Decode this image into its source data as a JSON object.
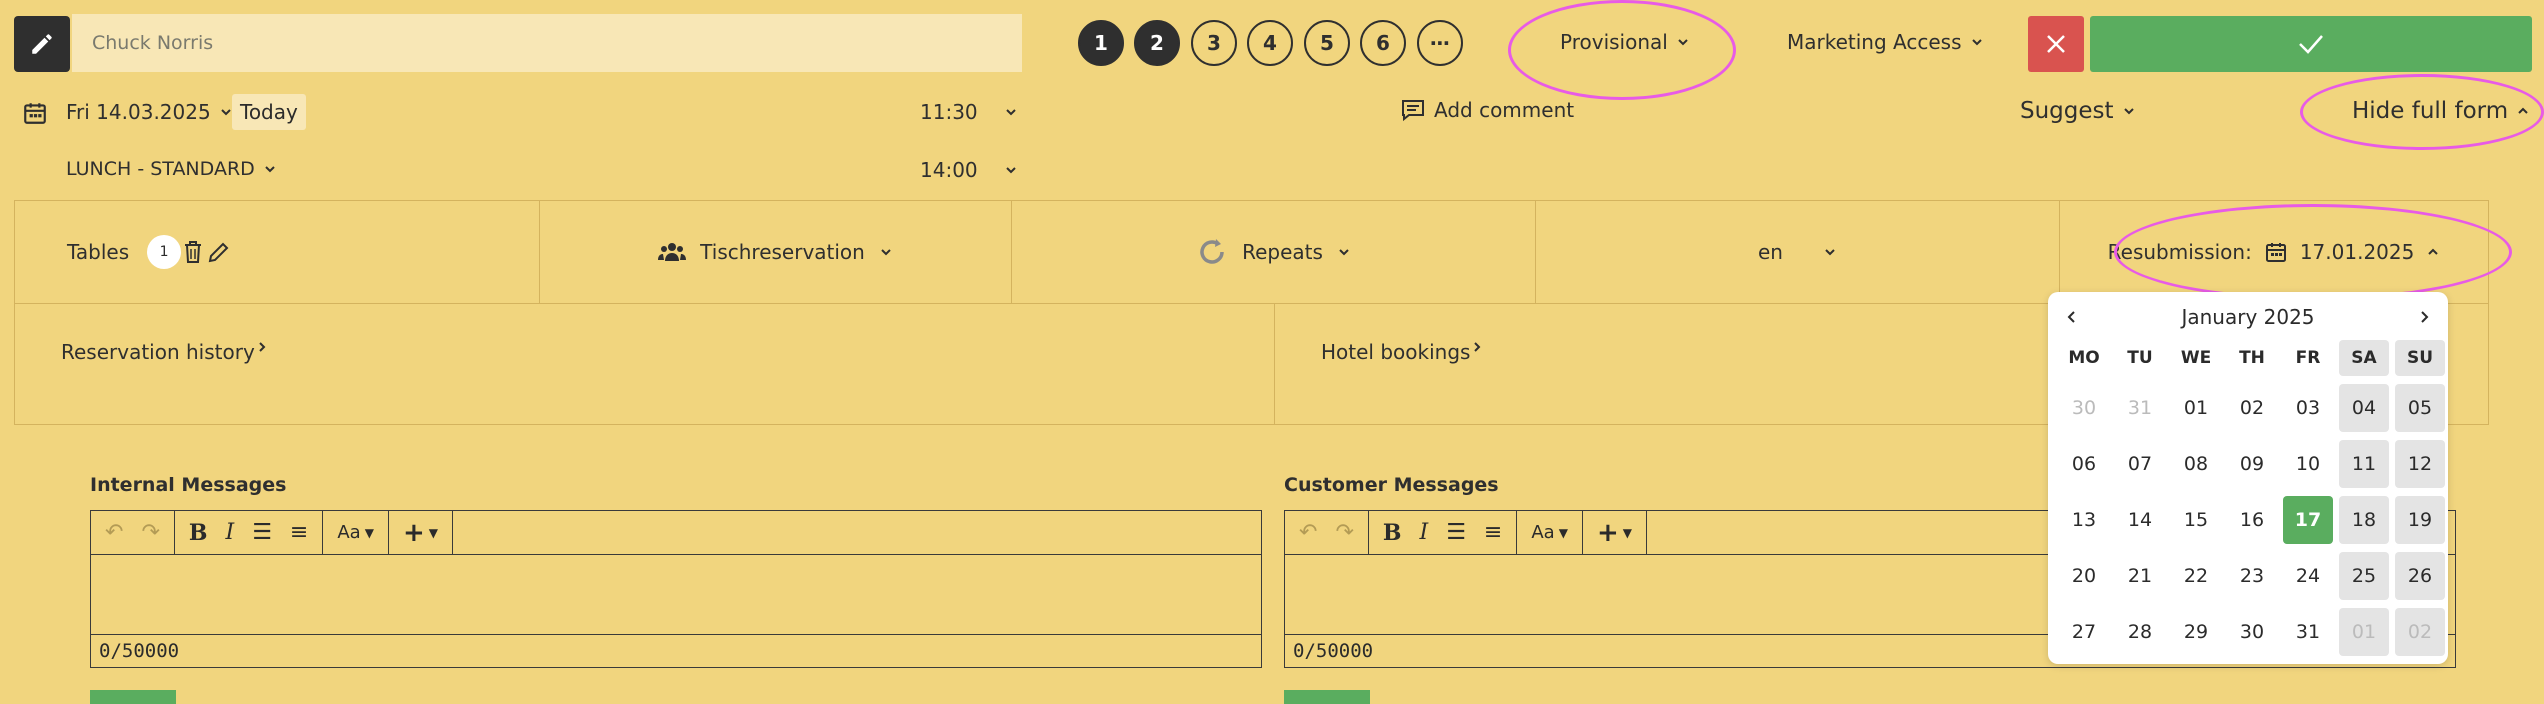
{
  "header": {
    "name_value": "Chuck Norris",
    "steps": [
      "1",
      "2",
      "3",
      "4",
      "5",
      "6",
      "⋯"
    ],
    "status": "Provisional",
    "marketing": "Marketing Access"
  },
  "row2": {
    "date": "Fri 14.03.2025",
    "today": "Today",
    "time_start": "11:30",
    "time_end": "14:00",
    "add_comment": "Add comment",
    "suggest": "Suggest",
    "hide_form": "Hide full form",
    "menu": "LUNCH - STANDARD"
  },
  "details": {
    "tables_label": "Tables",
    "tables_count": "1",
    "reservation_type": "Tischreservation",
    "repeats": "Repeats",
    "language": "en",
    "resubmission_label": "Resubmission:",
    "resubmission_date": "17.01.2025",
    "history": "Reservation history",
    "hotel": "Hotel bookings"
  },
  "editors": {
    "internal_label": "Internal Messages",
    "customer_label": "Customer Messages",
    "counter": "0/50000",
    "font_label": "Aa"
  },
  "calendar": {
    "month": "January 2025",
    "dow": [
      "MO",
      "TU",
      "WE",
      "TH",
      "FR",
      "SA",
      "SU"
    ],
    "weeks": [
      [
        "30",
        "31",
        "01",
        "02",
        "03",
        "04",
        "05"
      ],
      [
        "06",
        "07",
        "08",
        "09",
        "10",
        "11",
        "12"
      ],
      [
        "13",
        "14",
        "15",
        "16",
        "17",
        "18",
        "19"
      ],
      [
        "20",
        "21",
        "22",
        "23",
        "24",
        "25",
        "26"
      ],
      [
        "27",
        "28",
        "29",
        "30",
        "31",
        "01",
        "02"
      ]
    ],
    "selected": "17"
  },
  "colors": {
    "background": "#f1d57e",
    "primary": "#5aad5f",
    "danger": "#d9534f",
    "highlight": "#e85be6"
  }
}
